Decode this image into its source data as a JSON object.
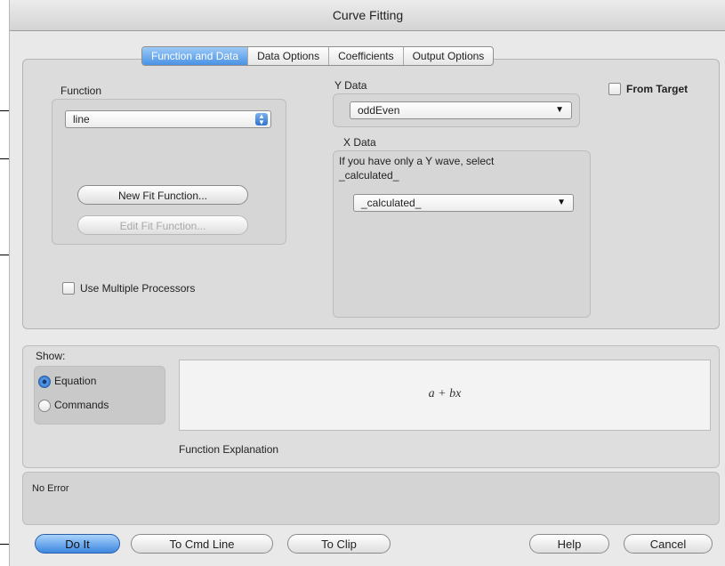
{
  "window": {
    "title": "Curve Fitting"
  },
  "tabs": [
    {
      "label": "Function and Data",
      "active": true
    },
    {
      "label": "Data Options"
    },
    {
      "label": "Coefficients"
    },
    {
      "label": "Output Options"
    }
  ],
  "function_group": {
    "label": "Function",
    "selected": "line",
    "new_fit_button": "New Fit Function...",
    "edit_fit_button": "Edit Fit Function..."
  },
  "y_data": {
    "label": "Y Data",
    "selected": "oddEven"
  },
  "x_data": {
    "label": "X Data",
    "hint_line1": "If you have only a Y wave, select",
    "hint_line2": "_calculated_",
    "selected": "_calculated_"
  },
  "from_target": {
    "label": "From Target",
    "checked": false
  },
  "multi_processors": {
    "label": "Use Multiple Processors",
    "checked": false
  },
  "show": {
    "label": "Show:",
    "options": [
      {
        "label": "Equation",
        "selected": true
      },
      {
        "label": "Commands",
        "selected": false
      }
    ]
  },
  "equation": {
    "text": "a + bx",
    "caption": "Function Explanation"
  },
  "error": {
    "text": "No Error"
  },
  "buttons": {
    "do_it": "Do It",
    "to_cmd_line": "To Cmd Line",
    "to_clip": "To Clip",
    "help": "Help",
    "cancel": "Cancel"
  },
  "colors": {
    "accent": "#4a92e4",
    "panel": "#dcdcdc",
    "window": "#e9e9e9"
  }
}
